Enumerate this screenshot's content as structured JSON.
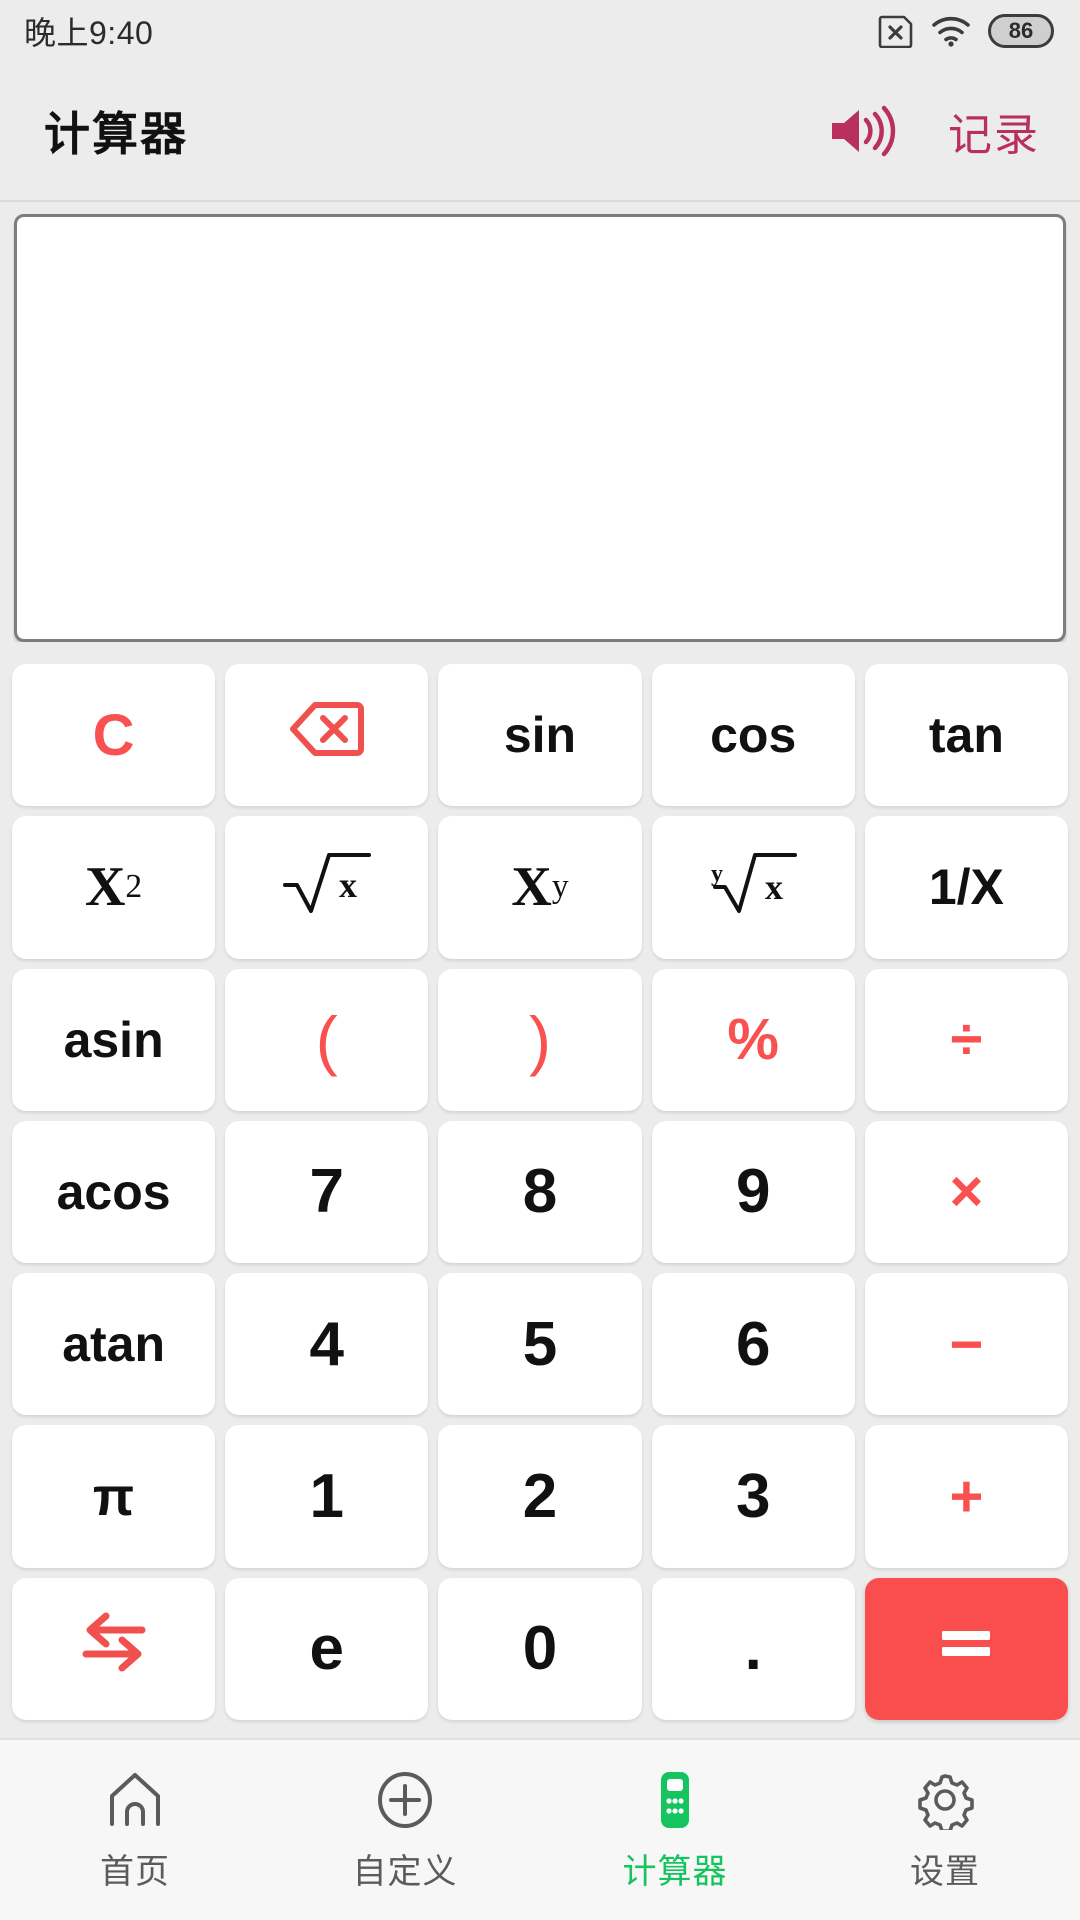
{
  "statusbar": {
    "time": "晚上9:40",
    "sim_icon": "sim-card-disabled-icon",
    "wifi_icon": "wifi-icon",
    "battery_level": "86",
    "battery_icon": "battery-icon"
  },
  "header": {
    "title": "计算器",
    "speaker_icon": "speaker-volume-icon",
    "history_label": "记录",
    "accent_color": "#b9305e"
  },
  "display": {
    "value": "",
    "placeholder": ""
  },
  "keypad": {
    "red_color": "#f8514f",
    "equals_bg": "#fa4d4d",
    "keys": [
      {
        "label": "C",
        "name": "key-clear",
        "style": "c"
      },
      {
        "label": "",
        "name": "key-backspace",
        "style": "icon-backspace"
      },
      {
        "label": "sin",
        "name": "key-sin",
        "style": "fn"
      },
      {
        "label": "cos",
        "name": "key-cos",
        "style": "fn"
      },
      {
        "label": "tan",
        "name": "key-tan",
        "style": "fn"
      },
      {
        "label": "X2",
        "name": "key-x-squared",
        "style": "serif-sup",
        "base": "X",
        "sup": "2"
      },
      {
        "label": "√x",
        "name": "key-square-root",
        "style": "sqrt"
      },
      {
        "label": "Xy",
        "name": "key-x-power-y",
        "style": "serif-sup",
        "base": "X",
        "sup": "y"
      },
      {
        "label": "y√x",
        "name": "key-nth-root",
        "style": "nthroot"
      },
      {
        "label": "1/X",
        "name": "key-reciprocal",
        "style": "fn"
      },
      {
        "label": "asin",
        "name": "key-asin",
        "style": "fn"
      },
      {
        "label": "(",
        "name": "key-open-paren",
        "style": "paren"
      },
      {
        "label": ")",
        "name": "key-close-paren",
        "style": "paren"
      },
      {
        "label": "%",
        "name": "key-percent",
        "style": "op"
      },
      {
        "label": "÷",
        "name": "key-divide",
        "style": "op"
      },
      {
        "label": "acos",
        "name": "key-acos",
        "style": "fn"
      },
      {
        "label": "7",
        "name": "key-7",
        "style": "digit"
      },
      {
        "label": "8",
        "name": "key-8",
        "style": "digit"
      },
      {
        "label": "9",
        "name": "key-9",
        "style": "digit"
      },
      {
        "label": "×",
        "name": "key-multiply",
        "style": "op"
      },
      {
        "label": "atan",
        "name": "key-atan",
        "style": "fn"
      },
      {
        "label": "4",
        "name": "key-4",
        "style": "digit"
      },
      {
        "label": "5",
        "name": "key-5",
        "style": "digit"
      },
      {
        "label": "6",
        "name": "key-6",
        "style": "digit"
      },
      {
        "label": "−",
        "name": "key-subtract",
        "style": "op"
      },
      {
        "label": "π",
        "name": "key-pi",
        "style": "pi"
      },
      {
        "label": "1",
        "name": "key-1",
        "style": "digit"
      },
      {
        "label": "2",
        "name": "key-2",
        "style": "digit"
      },
      {
        "label": "3",
        "name": "key-3",
        "style": "digit"
      },
      {
        "label": "+",
        "name": "key-add",
        "style": "op"
      },
      {
        "label": "",
        "name": "key-swap",
        "style": "icon-swap"
      },
      {
        "label": "e",
        "name": "key-e",
        "style": "digit"
      },
      {
        "label": "0",
        "name": "key-0",
        "style": "digit"
      },
      {
        "label": ".",
        "name": "key-decimal",
        "style": "dot"
      },
      {
        "label": "=",
        "name": "key-equals",
        "style": "equals"
      }
    ]
  },
  "navbar": {
    "active_color": "#16c45f",
    "items": [
      {
        "label": "首页",
        "icon": "home-icon",
        "name": "nav-home",
        "active": false
      },
      {
        "label": "自定义",
        "icon": "plus-circle-icon",
        "name": "nav-custom",
        "active": false
      },
      {
        "label": "计算器",
        "icon": "calculator-icon",
        "name": "nav-calculator",
        "active": true
      },
      {
        "label": "设置",
        "icon": "gear-icon",
        "name": "nav-settings",
        "active": false
      }
    ]
  }
}
